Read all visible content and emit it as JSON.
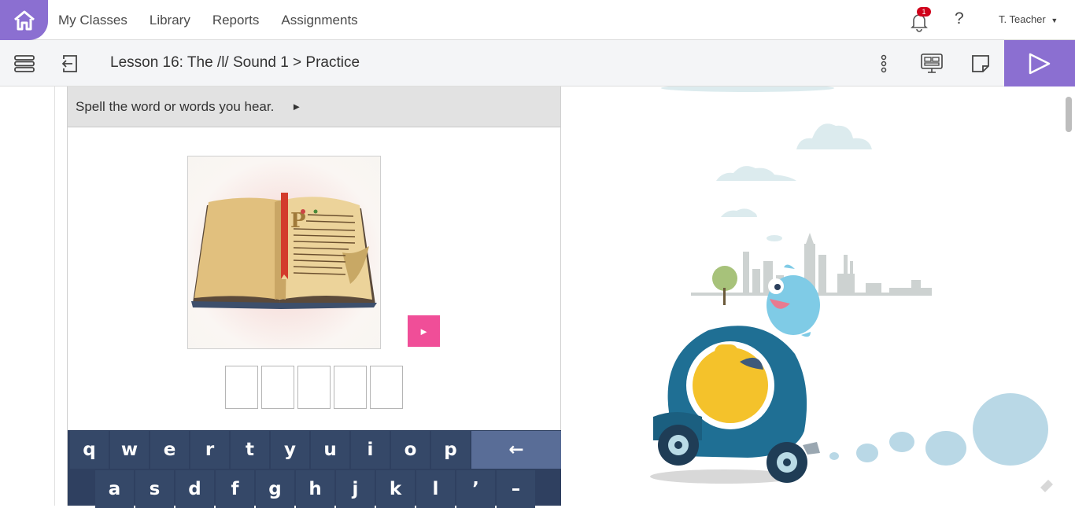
{
  "nav": {
    "links": [
      "My Classes",
      "Library",
      "Reports",
      "Assignments"
    ],
    "notification_count": "1",
    "help": "?",
    "user": "T. Teacher"
  },
  "toolbar": {
    "title": "Lesson 16: The /l/ Sound 1 > Practice"
  },
  "activity": {
    "prompt": "Spell the word or words you hear.",
    "prompt_play": "►",
    "audio_play": "►",
    "letter_boxes": 5
  },
  "keyboard": {
    "row1": [
      "q",
      "w",
      "e",
      "r",
      "t",
      "y",
      "u",
      "i",
      "o",
      "p"
    ],
    "backspace": "←",
    "row2": [
      "a",
      "s",
      "d",
      "f",
      "g",
      "h",
      "j",
      "k",
      "l",
      "’",
      "–"
    ]
  },
  "colors": {
    "accent": "#8b6fd1",
    "audio_button": "#f04e98",
    "keyboard": "#354868",
    "backspace_key": "#596d97"
  }
}
